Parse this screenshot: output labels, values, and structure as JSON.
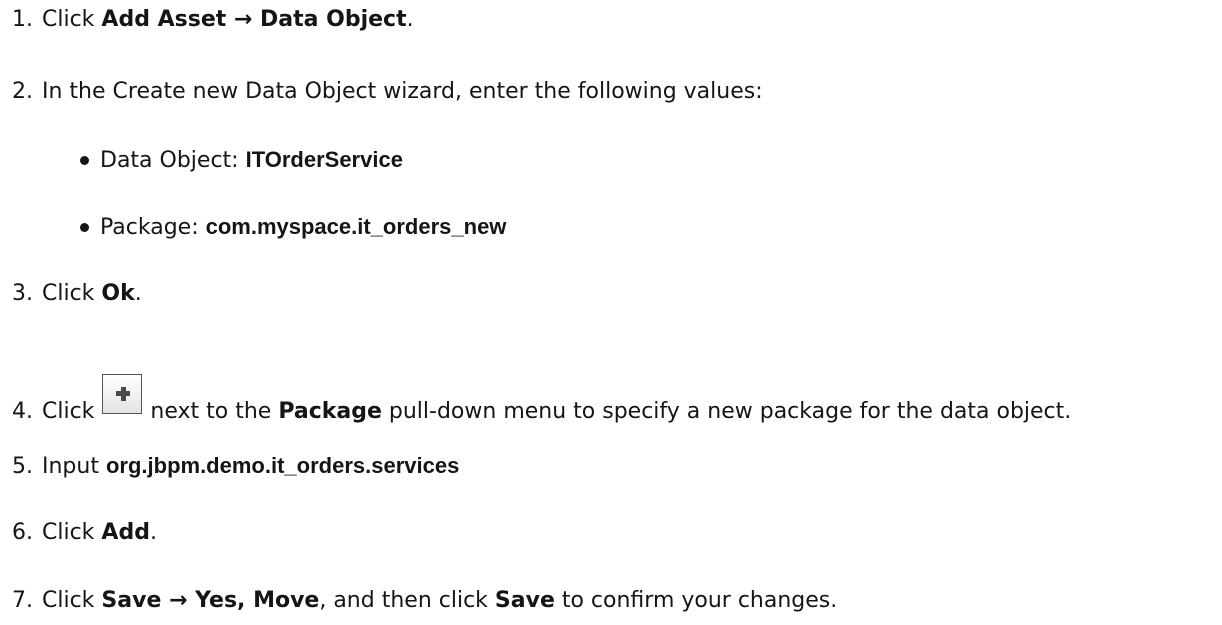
{
  "steps": [
    {
      "num": "1.",
      "pre": "Click ",
      "ui": "Add Asset → Data Object",
      "post": "."
    },
    {
      "num": "2.",
      "text": "In the Create new Data Object wizard, enter the following values:"
    },
    {
      "num": "3.",
      "pre": "Click ",
      "ui": "Ok",
      "post": "."
    },
    {
      "num": "4.",
      "pre": "Click ",
      "mid": " next to the ",
      "ui": "Package",
      "post": " pull-down menu to specify a new package for the data object."
    },
    {
      "num": "5.",
      "pre": "Input ",
      "value": "org.jbpm.demo.it_orders.services"
    },
    {
      "num": "6.",
      "pre": "Click ",
      "ui": "Add",
      "post": "."
    },
    {
      "num": "7.",
      "pre": "Click ",
      "ui1": "Save → Yes, Move",
      "mid": ", and then click ",
      "ui2": "Save",
      "post": " to confirm your changes."
    }
  ],
  "fields": [
    {
      "label": "Data Object: ",
      "value": "ITOrderService"
    },
    {
      "label": "Package: ",
      "value": "com.myspace.it_orders_new"
    }
  ],
  "icons": {
    "add_button": "plus-icon"
  }
}
